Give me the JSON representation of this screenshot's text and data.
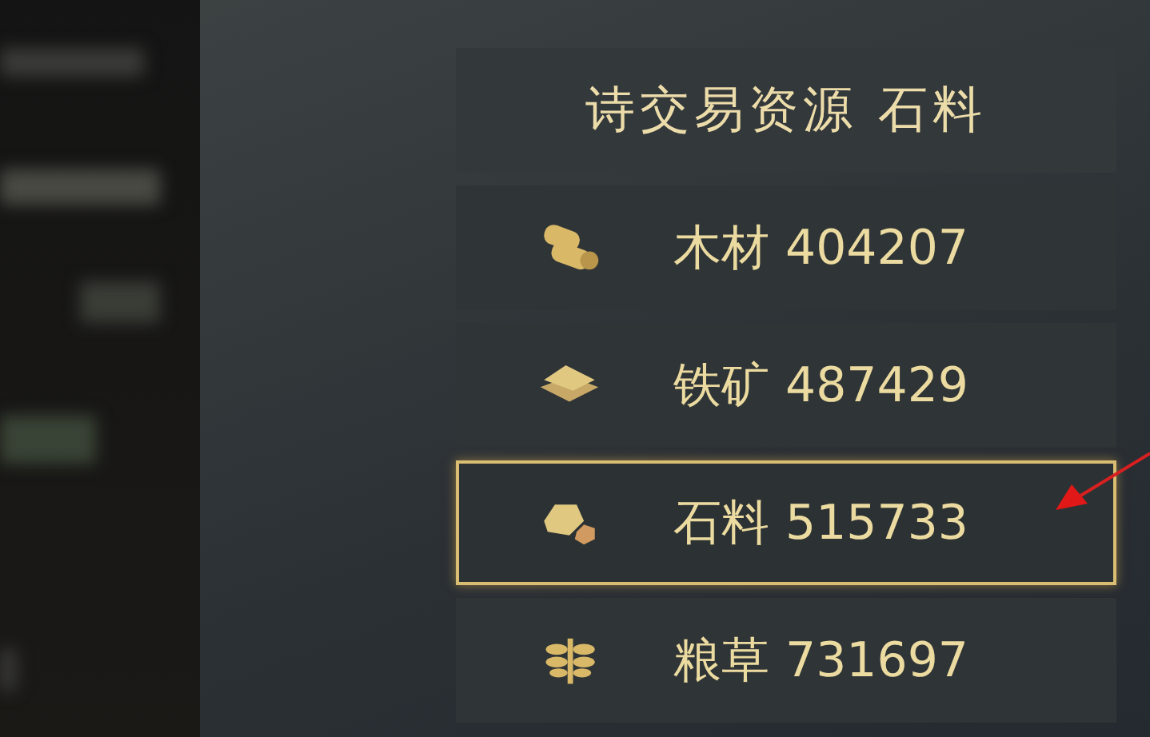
{
  "header": {
    "title": "诗交易资源 石料"
  },
  "resources": [
    {
      "kind": "wood",
      "name": "木材",
      "amount": "404207",
      "selected": false
    },
    {
      "kind": "iron",
      "name": "铁矿",
      "amount": "487429",
      "selected": false
    },
    {
      "kind": "stone",
      "name": "石料",
      "amount": "515733",
      "selected": true
    },
    {
      "kind": "grain",
      "name": "粮草",
      "amount": "731697",
      "selected": false
    }
  ]
}
